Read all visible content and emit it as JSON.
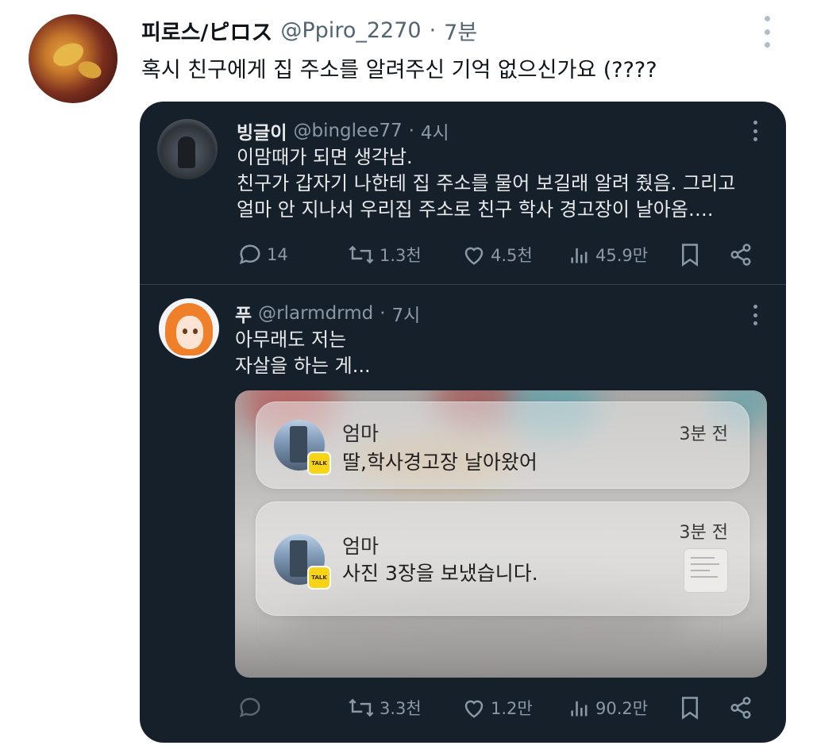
{
  "tweet": {
    "author_name": "피로스/ピロス",
    "handle": "@Ppiro_2270",
    "separator": "·",
    "time": "7분",
    "text": "혹시 친구에게 집 주소를 알려주신 기억 없으신가요 (????"
  },
  "quote1": {
    "author_name": "빙글이",
    "handle": "@binglee77",
    "separator": "·",
    "time": "4시",
    "lines": [
      "이맘때가 되면 생각남.",
      "친구가 갑자기 나한테 집 주소를 물어 보길래 알려 줬음. 그리고",
      "얼마 안 지나서 우리집 주소로 친구 학사 경고장이 날아옴…."
    ],
    "actions": {
      "replies": "14",
      "reposts": "1.3천",
      "likes": "4.5천",
      "views": "45.9만"
    }
  },
  "quote2": {
    "author_name": "푸",
    "handle": "@rlarmdrmd",
    "separator": "·",
    "time": "7시",
    "lines": [
      "아무래도 저는",
      "자살을 하는 게..."
    ],
    "actions": {
      "replies": "",
      "reposts": "3.3천",
      "likes": "1.2만",
      "views": "90.2만"
    }
  },
  "notifications": [
    {
      "title": "엄마",
      "message": "딸,학사경고장 날아왔어",
      "time": "3분 전",
      "badge": "TALK"
    },
    {
      "title": "엄마",
      "message": "사진 3장을 보냈습니다.",
      "time": "3분 전",
      "badge": "TALK"
    }
  ],
  "colors": {
    "card_bg": "#15202b",
    "muted_text": "#8b98a5",
    "kakao_yellow": "#f7d417"
  }
}
